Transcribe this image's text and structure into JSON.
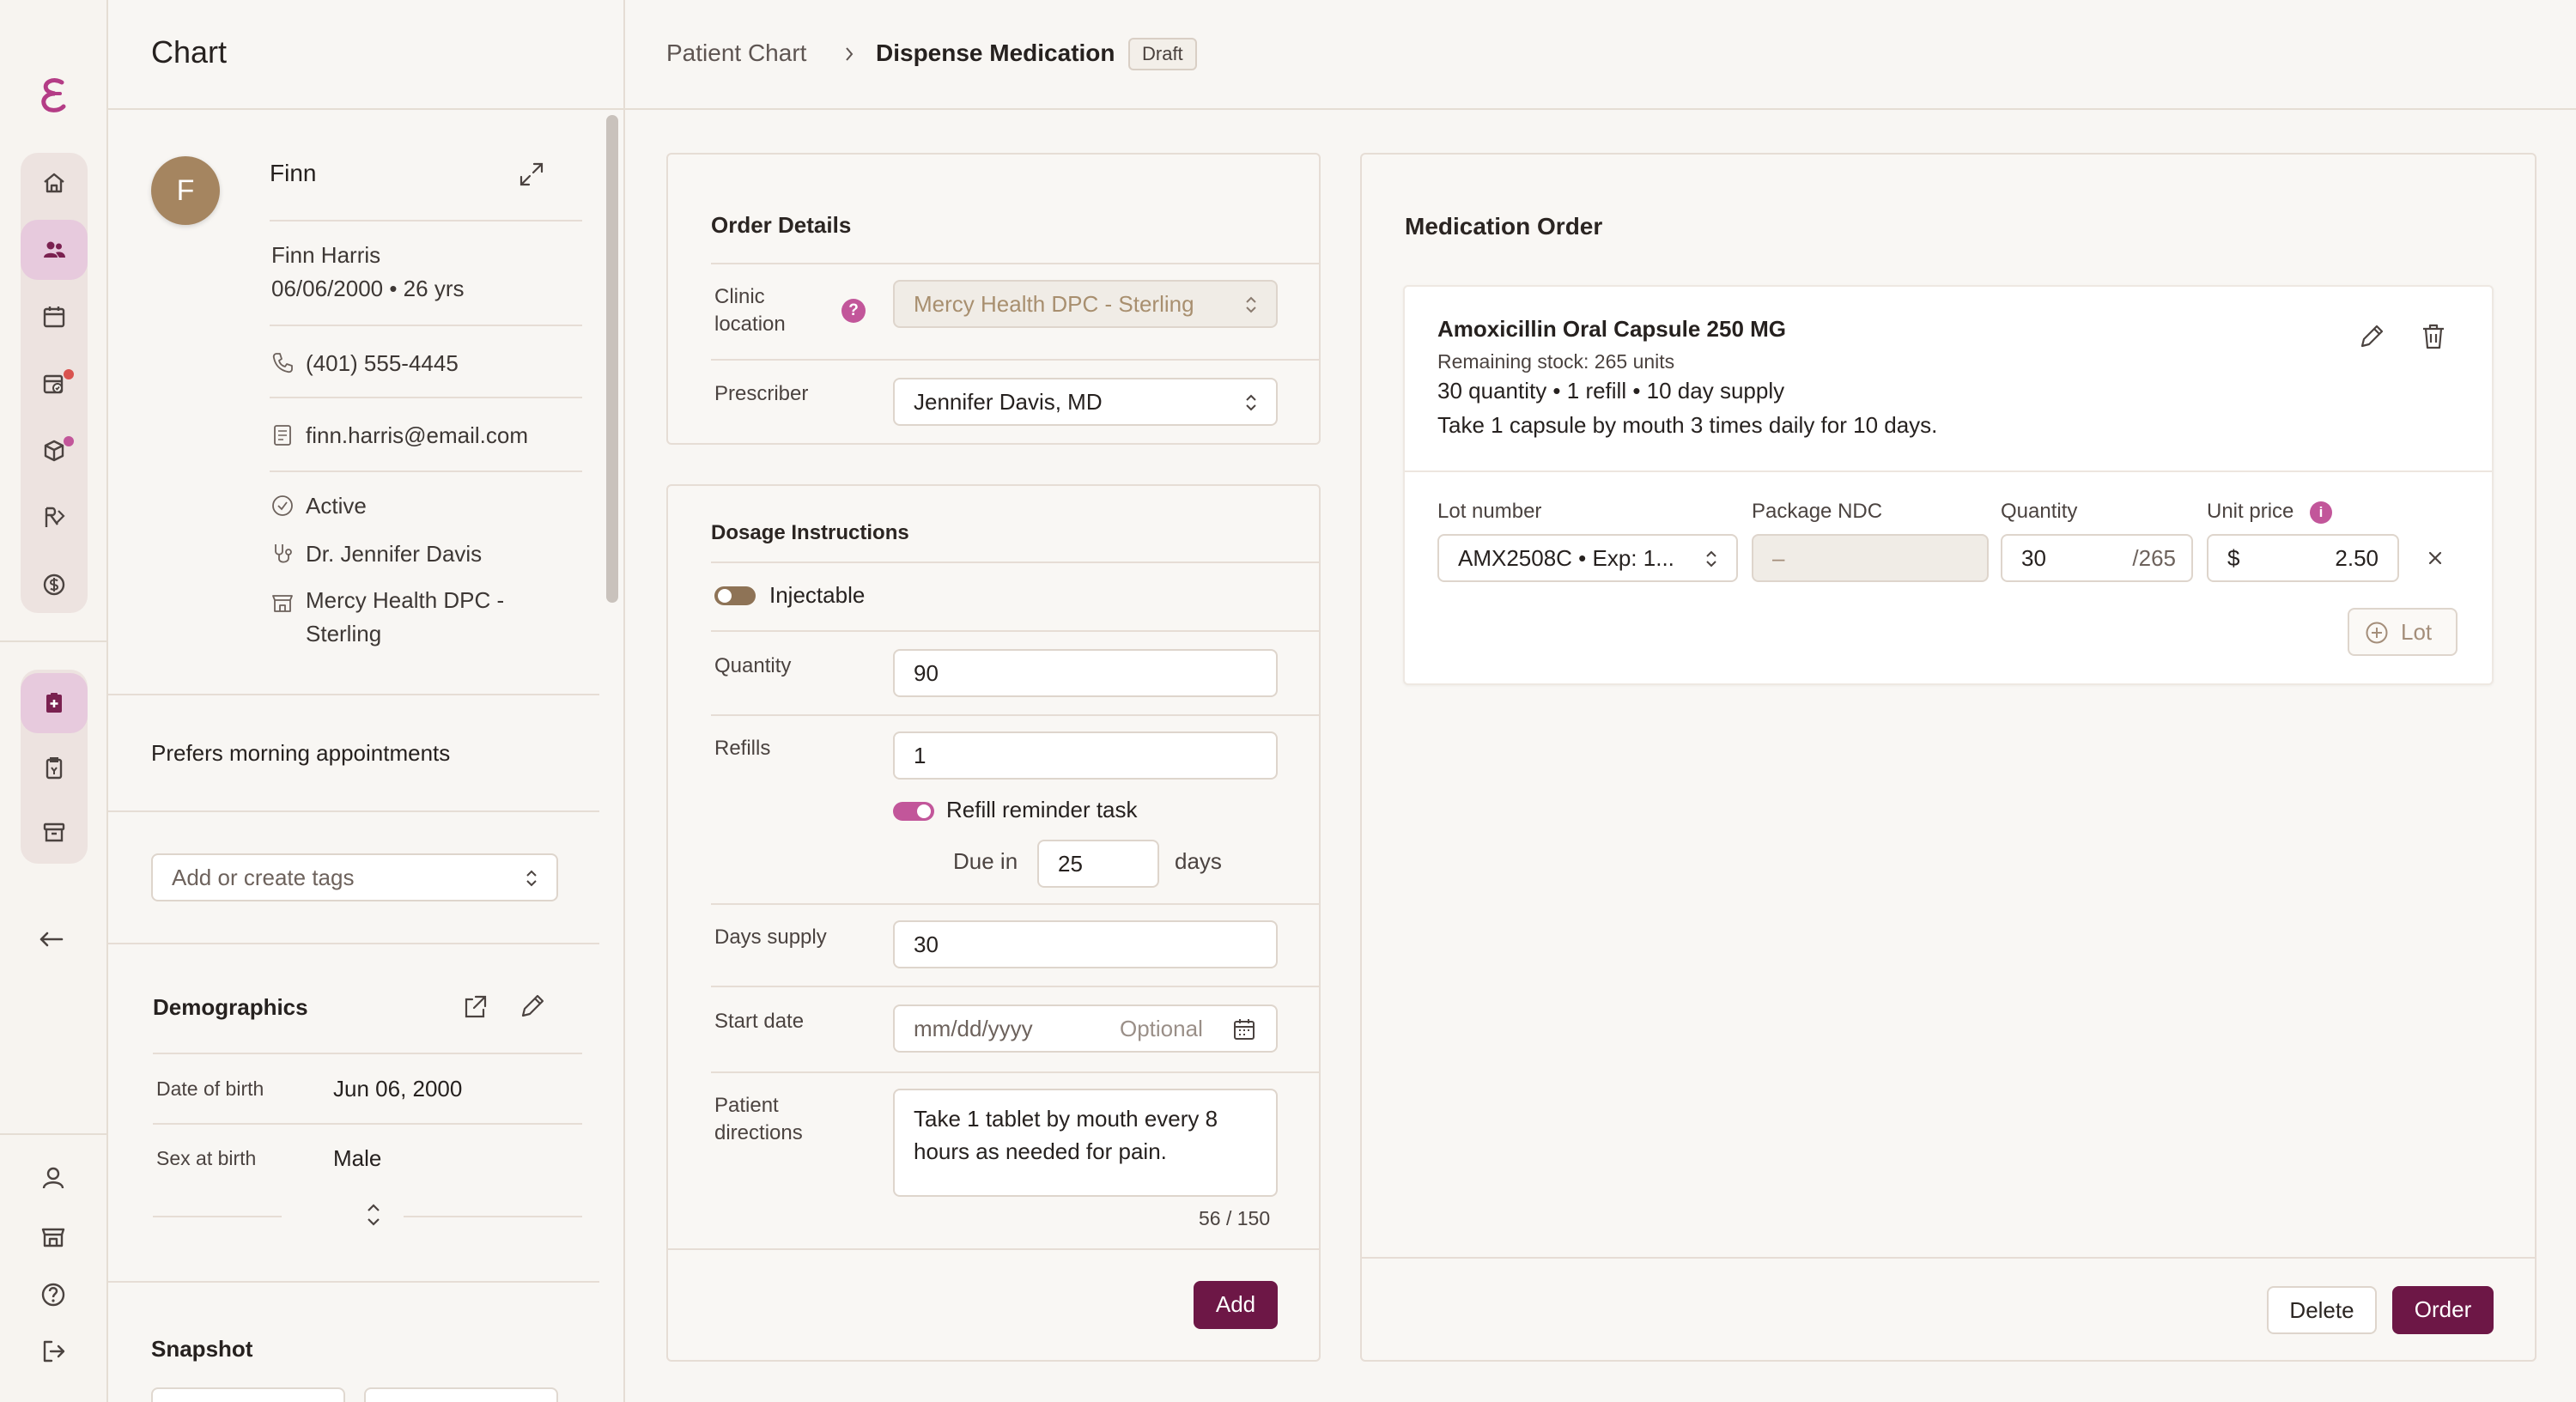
{
  "rail": {
    "logo": "brand-logo",
    "items": [
      "home-icon",
      "patients-icon",
      "calendar-icon",
      "tasks-icon",
      "inventory-icon",
      "prescriptions-icon",
      "billing-icon"
    ],
    "lower_items": [
      "dispense-icon",
      "lab-icon",
      "archive-icon"
    ],
    "collapse": "arrow-left-icon",
    "bottom_items": [
      "user-icon",
      "store-icon",
      "help-icon",
      "logout-icon"
    ],
    "alert_color": "#d9534f",
    "accent_color": "#c2569a"
  },
  "chart": {
    "title": "Chart",
    "patient": {
      "avatar_initial": "F",
      "short_name": "Finn",
      "full_name": "Finn Harris",
      "dob_age": "06/06/2000 • 26 yrs",
      "phone": "(401) 555-4445",
      "email": "finn.harris@email.com",
      "status": "Active",
      "provider": "Dr. Jennifer Davis",
      "location_line1": "Mercy Health DPC -",
      "location_line2": "Sterling"
    },
    "note": "Prefers morning appointments",
    "tags_placeholder": "Add or create tags",
    "demographics": {
      "title": "Demographics",
      "rows": [
        {
          "label": "Date of birth",
          "value": "Jun 06, 2000"
        },
        {
          "label": "Sex at birth",
          "value": "Male"
        }
      ]
    },
    "snapshot_title": "Snapshot"
  },
  "breadcrumb": {
    "parent": "Patient Chart",
    "current": "Dispense Medication",
    "badge": "Draft"
  },
  "order_details": {
    "title": "Order Details",
    "clinic_label_1": "Clinic",
    "clinic_label_2": "location",
    "clinic_value": "Mercy Health DPC - Sterling",
    "prescriber_label": "Prescriber",
    "prescriber_value": "Jennifer Davis, MD"
  },
  "dosage": {
    "title": "Dosage Instructions",
    "injectable_label": "Injectable",
    "injectable_on": false,
    "quantity_label": "Quantity",
    "quantity_value": "90",
    "refills_label": "Refills",
    "refills_value": "1",
    "refill_reminder_label": "Refill reminder task",
    "refill_reminder_on": true,
    "due_in_label": "Due in",
    "due_in_value": "25",
    "days_label": "days",
    "days_supply_label": "Days supply",
    "days_supply_value": "30",
    "start_date_label": "Start date",
    "start_date_placeholder": "mm/dd/yyyy",
    "start_date_hint": "Optional",
    "directions_label_1": "Patient",
    "directions_label_2": "directions",
    "directions_line1": "Take 1 tablet by mouth every 8",
    "directions_line2": "hours as needed for pain.",
    "char_count": "56 / 150",
    "add_button": "Add"
  },
  "medication_order": {
    "title": "Medication Order",
    "drug_name": "Amoxicillin Oral Capsule 250 MG",
    "stock": "Remaining stock: 265 units",
    "summary": "30 quantity • 1 refill • 10 day supply",
    "sig": "Take 1 capsule by mouth 3 times daily for 10 days.",
    "lot_label": "Lot number",
    "lot_value": "AMX2508C • Exp: 1...",
    "ndc_label": "Package NDC",
    "ndc_value": "–",
    "qty_label": "Quantity",
    "qty_value": "30",
    "qty_max": "/265",
    "price_label": "Unit price",
    "currency": "$",
    "price_value": "2.50",
    "add_lot_button": "Lot",
    "delete_button": "Delete",
    "order_button": "Order"
  },
  "colors": {
    "primary": "#6d1746",
    "accent": "#c2569a",
    "avatar": "#a58560",
    "toggle_off": "#8e7356"
  }
}
